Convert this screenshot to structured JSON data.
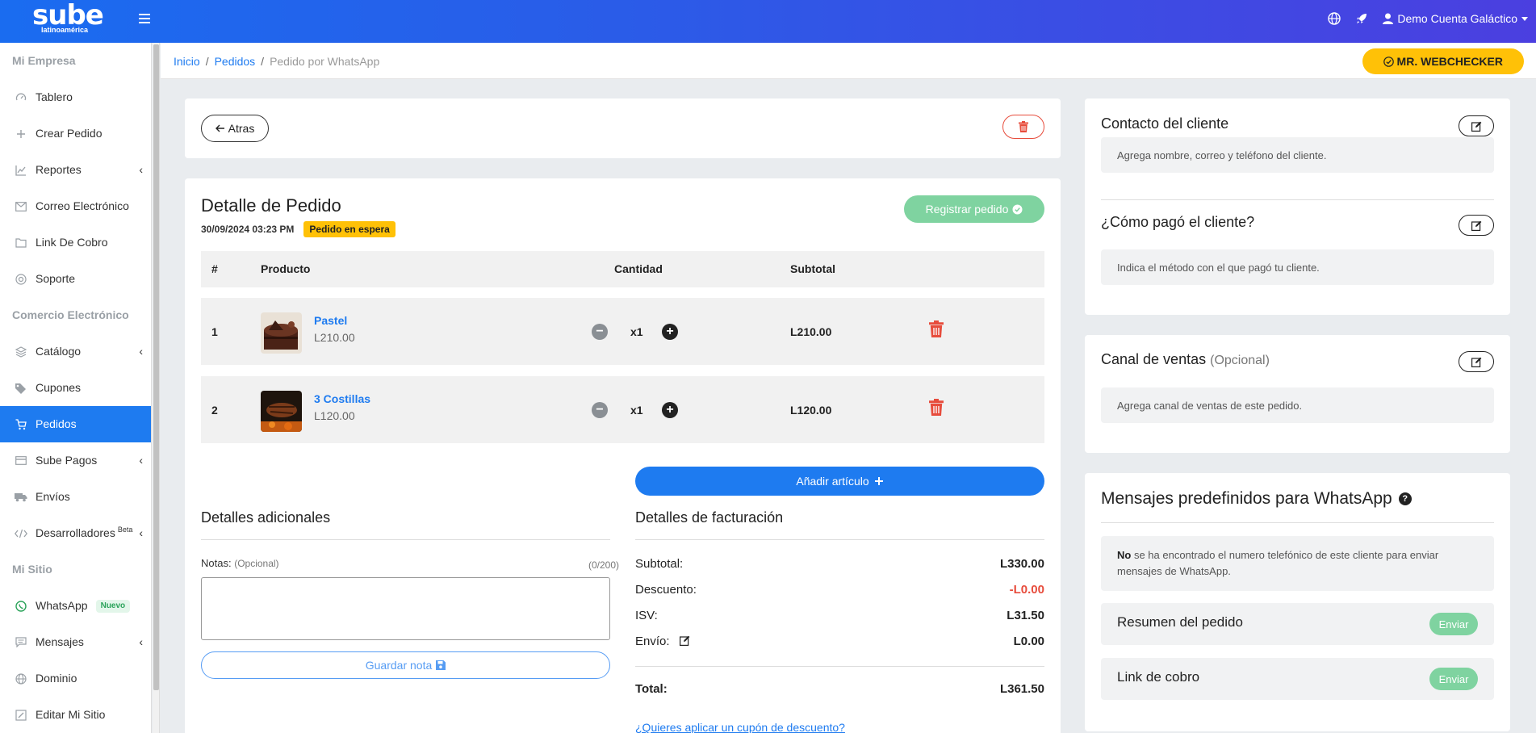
{
  "header": {
    "logo_main": "sube",
    "logo_sub": "latinoamérica",
    "user_name": "Demo Cuenta Galáctico"
  },
  "sidebar": {
    "section_empresa": "Mi Empresa",
    "section_comercio": "Comercio Electrónico",
    "section_sitio": "Mi Sitio",
    "items": {
      "tablero": "Tablero",
      "crear_pedido": "Crear Pedido",
      "reportes": "Reportes",
      "correo": "Correo Electrónico",
      "link_cobro": "Link De Cobro",
      "soporte": "Soporte",
      "catalogo": "Catálogo",
      "cupones": "Cupones",
      "pedidos": "Pedidos",
      "sube_pagos": "Sube Pagos",
      "envios": "Envíos",
      "desarrolladores": "Desarrolladores",
      "desarrolladores_badge": "Beta",
      "whatsapp": "WhatsApp",
      "whatsapp_badge": "Nuevo",
      "mensajes": "Mensajes",
      "dominio": "Dominio",
      "editar_sitio": "Editar Mi Sitio"
    }
  },
  "breadcrumb": {
    "home": "Inicio",
    "orders": "Pedidos",
    "current": "Pedido por WhatsApp"
  },
  "webchecker_label": "MR. WEBCHECKER",
  "top_card": {
    "back_label": "Atras"
  },
  "order": {
    "title": "Detalle de Pedido",
    "date": "30/09/2024 03:23 PM",
    "status": "Pedido en espera",
    "register_label": "Registrar pedido",
    "columns": {
      "num": "#",
      "product": "Producto",
      "qty": "Cantidad",
      "subtotal": "Subtotal"
    },
    "items": [
      {
        "num": "1",
        "name": "Pastel",
        "price": "L210.00",
        "qty": "x1",
        "subtotal": "L210.00"
      },
      {
        "num": "2",
        "name": "3 Costillas",
        "price": "L120.00",
        "qty": "x1",
        "subtotal": "L120.00"
      }
    ],
    "add_item_label": "Añadir artículo"
  },
  "additional": {
    "title": "Detalles adicionales",
    "notes_label": "Notas:",
    "notes_optional": "(Opcional)",
    "notes_count": "(0/200)",
    "notes_value": "",
    "save_note_label": "Guardar nota"
  },
  "billing": {
    "title": "Detalles de facturación",
    "subtotal_label": "Subtotal:",
    "subtotal_value": "L330.00",
    "discount_label": "Descuento:",
    "discount_value": "-L0.00",
    "tax_label": "ISV:",
    "tax_value": "L31.50",
    "shipping_label": "Envío:",
    "shipping_value": "L0.00",
    "total_label": "Total:",
    "total_value": "L361.50",
    "coupon_link": "¿Quieres aplicar un cupón de descuento?"
  },
  "customer": {
    "contact_title": "Contacto del cliente",
    "contact_placeholder": "Agrega nombre, correo y teléfono del cliente.",
    "payment_title": "¿Cómo pagó el cliente?",
    "payment_placeholder": "Indica el método con el que pagó tu cliente."
  },
  "sales_channel": {
    "title": "Canal de ventas",
    "optional": "(Opcional)",
    "placeholder": "Agrega canal de ventas de este pedido."
  },
  "whatsapp_msgs": {
    "title": "Mensajes predefinidos para WhatsApp",
    "help": "?",
    "notice_bold": "No",
    "notice_rest": " se ha encontrado el numero telefónico de este cliente para enviar mensajes de WhatsApp.",
    "summary_label": "Resumen del pedido",
    "link_label": "Link de cobro",
    "send_label": "Enviar"
  },
  "colors": {
    "primary": "#1e7bf0",
    "warning": "#ffc107",
    "danger": "#e74c3c",
    "success_light": "#7fd3a0"
  }
}
